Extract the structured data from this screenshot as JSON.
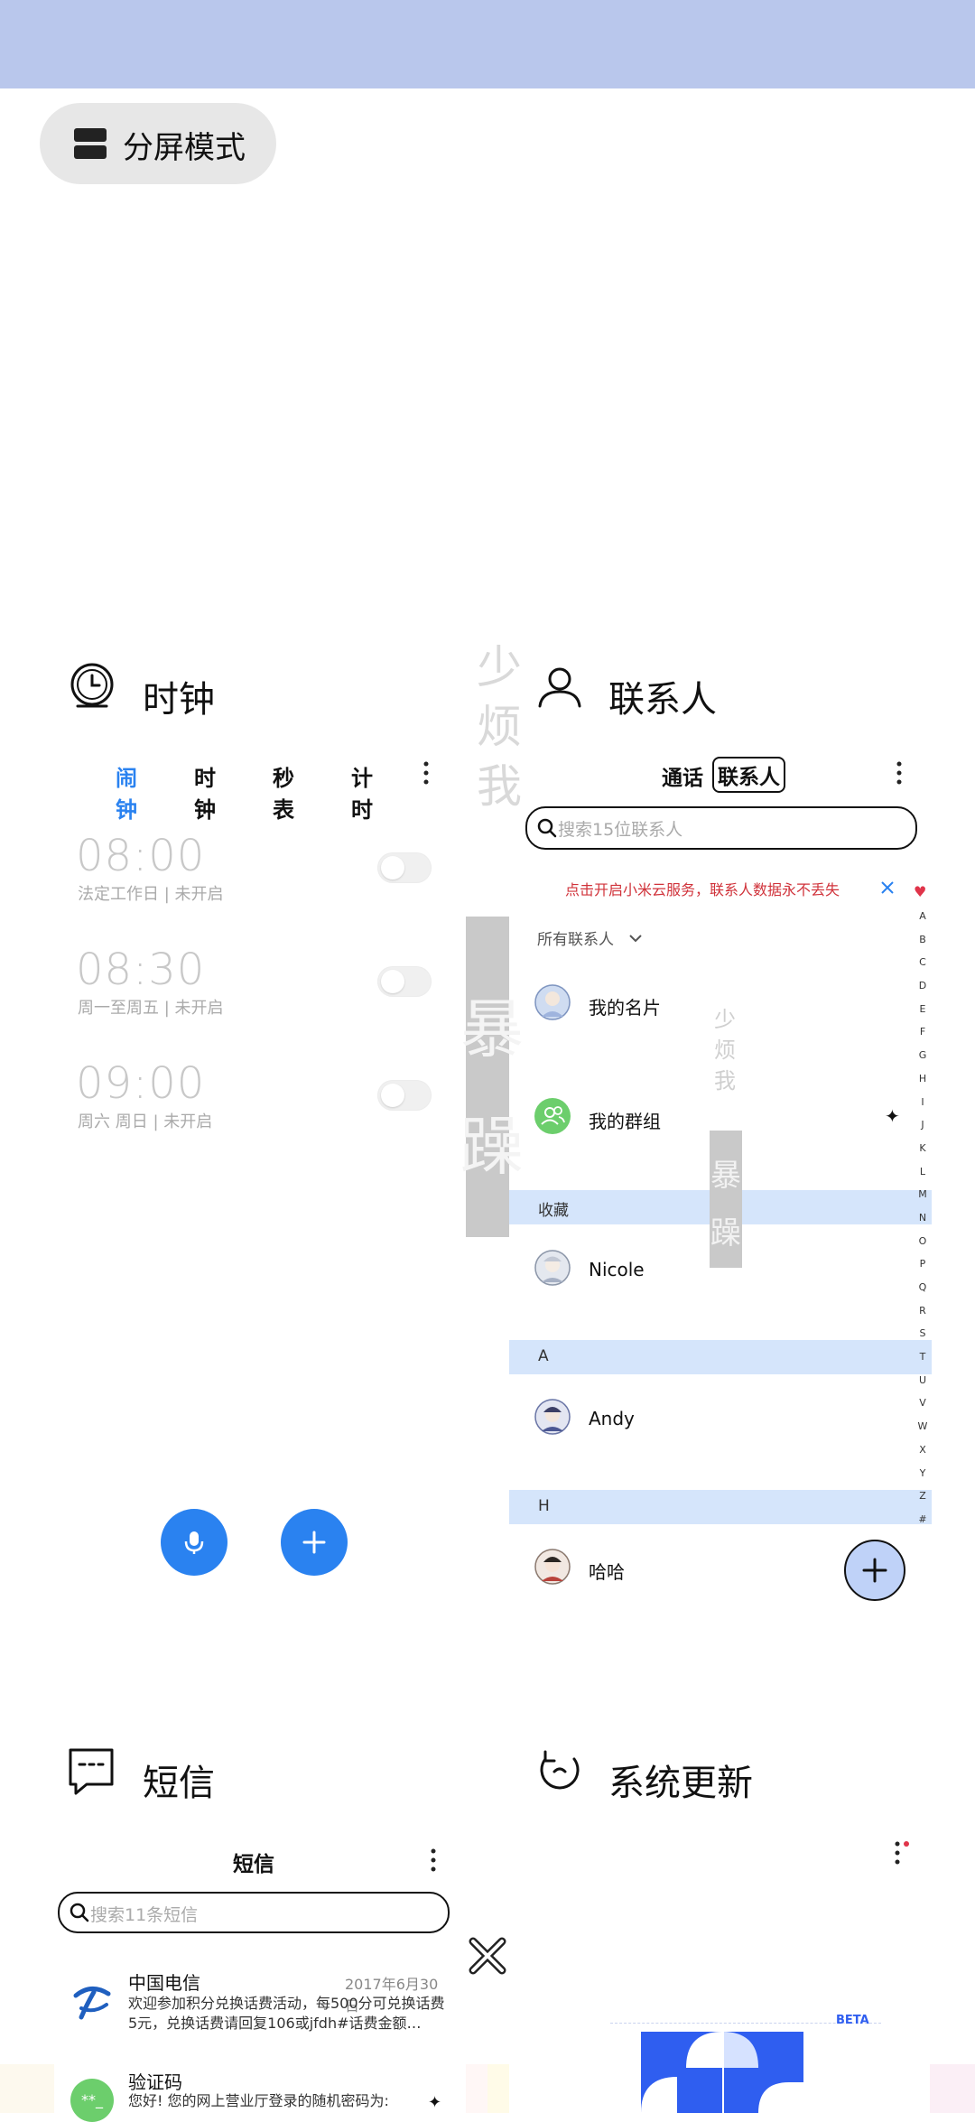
{
  "split_mode": {
    "label": "分屏模式"
  },
  "clock_card": {
    "title": "时钟",
    "tabs": [
      "闹钟",
      "时钟",
      "秒表",
      "计时"
    ],
    "active_tab_color": "#2a82f0",
    "alarms": [
      {
        "time": "08:00",
        "subtitle": "法定工作日 | 未开启"
      },
      {
        "time": "08:30",
        "subtitle": "周一至周五 | 未开启"
      },
      {
        "time": "09:00",
        "subtitle": "周六 周日 | 未开启"
      }
    ]
  },
  "contacts_card": {
    "title": "联系人",
    "tabs": [
      "通话",
      "联系人"
    ],
    "search_placeholder": "搜索15位联系人",
    "cloud_banner": "点击开启小米云服务，联系人数据永不丢失",
    "filter_label": "所有联系人",
    "my_card": "我的名片",
    "my_groups": "我的群组",
    "sections": [
      {
        "header": "收藏",
        "contact": "Nicole"
      },
      {
        "header": "A",
        "contact": "Andy"
      },
      {
        "header": "H",
        "contact": "哈哈"
      }
    ],
    "index_letters": [
      "A",
      "B",
      "C",
      "D",
      "E",
      "F",
      "G",
      "H",
      "I",
      "J",
      "K",
      "L",
      "M",
      "N",
      "O",
      "P",
      "Q",
      "R",
      "S",
      "T",
      "U",
      "V",
      "W",
      "X",
      "Y",
      "Z",
      "#"
    ],
    "banner_color": "#d0323a"
  },
  "overlay_text": {
    "vertical_small": [
      "少",
      "烦",
      "我"
    ],
    "vertical_big": [
      "暴",
      "躁"
    ]
  },
  "messages_card": {
    "title": "短信",
    "header": "短信",
    "search_placeholder": "搜索11条短信",
    "items": [
      {
        "sender": "中国电信",
        "date": "2017年6月30日",
        "preview": "欢迎参加积分兑换话费活动，每500分可兑换话费5元，兑换话费请回复106或jfdh#话费金额…"
      },
      {
        "sender": "验证码",
        "preview": "您好! 您的网上营业厅登录的随机密码为:"
      }
    ]
  },
  "update_card": {
    "title": "系统更新",
    "beta_label": "BETA",
    "accent": "#2f5ef0"
  }
}
